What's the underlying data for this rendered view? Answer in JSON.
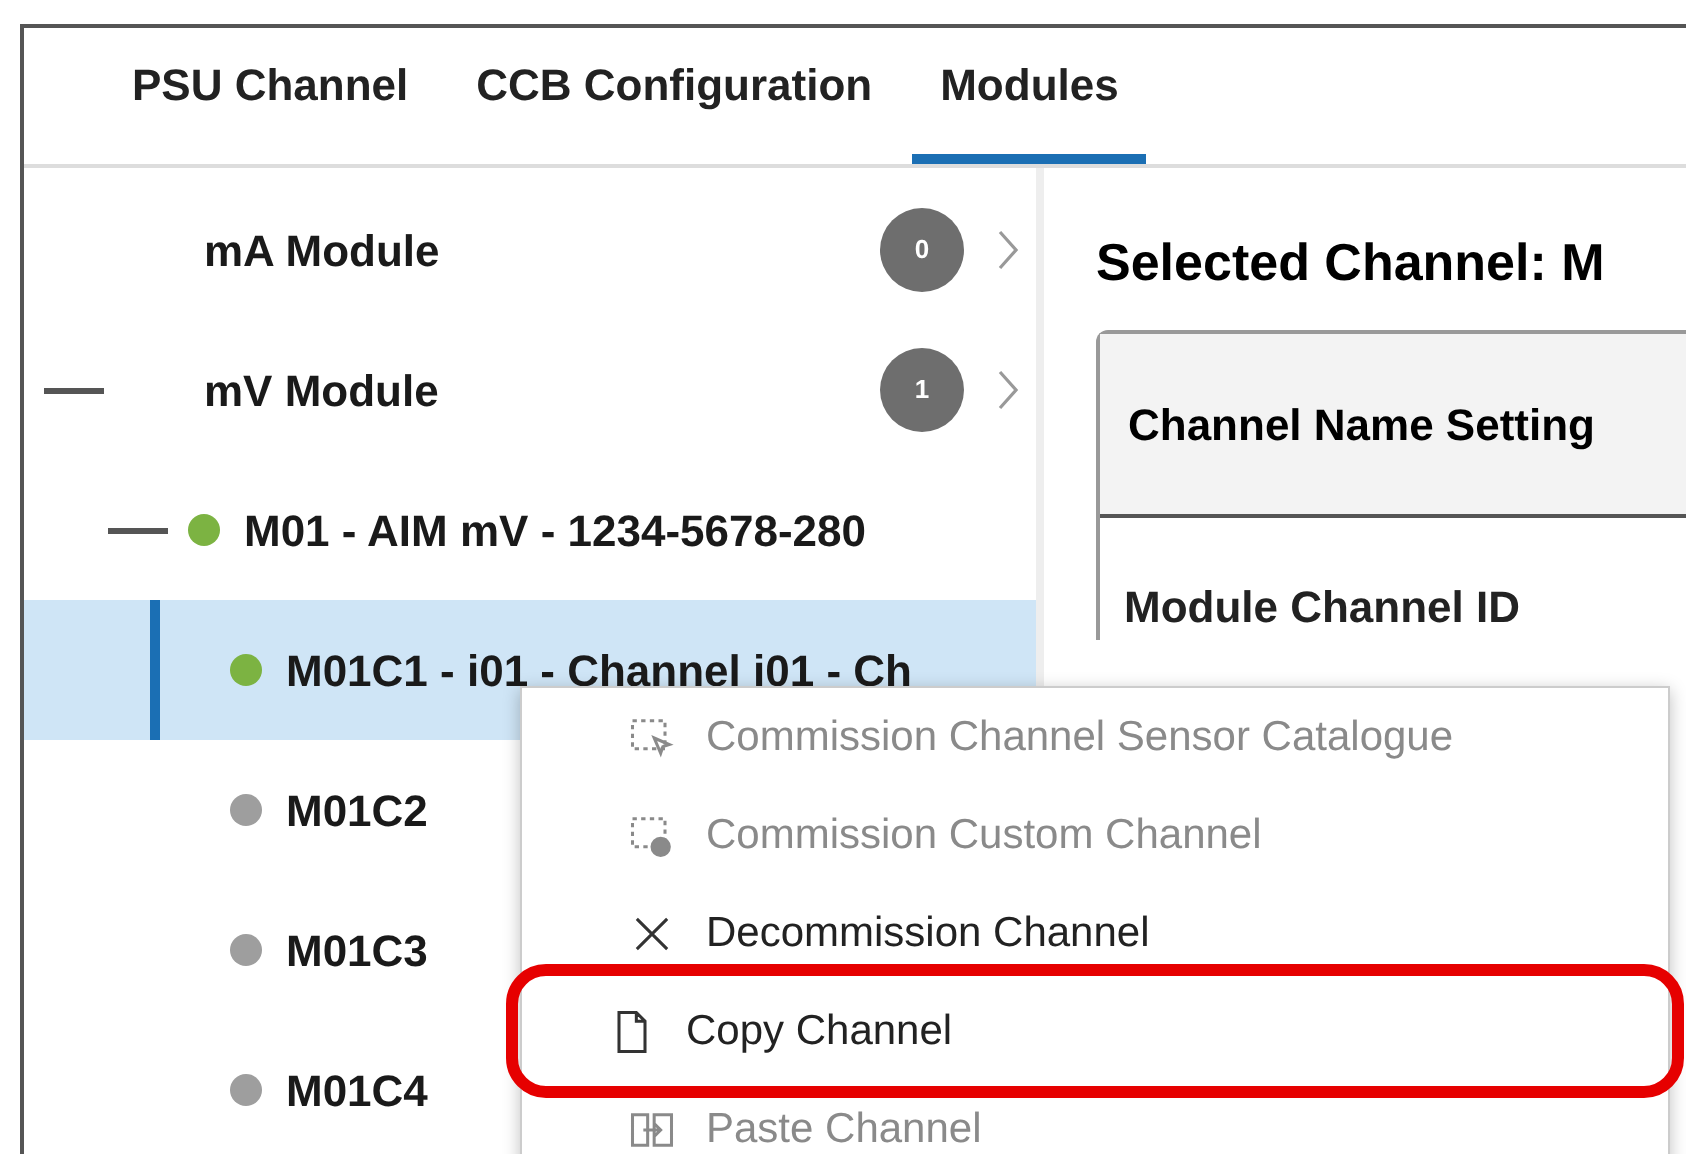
{
  "tabs": [
    {
      "label": "PSU Channel",
      "selected": false
    },
    {
      "label": "CCB Configuration",
      "selected": false
    },
    {
      "label": "Modules",
      "selected": true
    }
  ],
  "tree": [
    {
      "label": "mA Module",
      "badge": "0",
      "expanded": false,
      "selected": false
    },
    {
      "label": "mV Module",
      "badge": "1",
      "expanded": true,
      "selected": false,
      "children": [
        {
          "label": "M01 - AIM mV - 1234-5678-280",
          "color": "#7cb342",
          "expanded": true,
          "selected": false,
          "children": [
            {
              "label": "M01C1 - i01 - Channel i01 - Ch",
              "color": "#7cb342",
              "selected": true
            },
            {
              "label": "M01C2",
              "color": "#9e9e9e",
              "selected": false
            },
            {
              "label": "M01C3",
              "color": "#9e9e9e",
              "selected": false
            },
            {
              "label": "M01C4",
              "color": "#9e9e9e",
              "selected": false
            }
          ]
        }
      ]
    }
  ],
  "detail": {
    "title": "Selected Channel: M",
    "section_header": "Channel Name Setting",
    "field_label": "Module Channel ID"
  },
  "context_menu": [
    {
      "kind": "sensor",
      "label": "Commission Channel Sensor Catalogue",
      "disabled": true,
      "highlighted": false
    },
    {
      "kind": "custom",
      "label": "Commission Custom Channel",
      "disabled": true,
      "highlighted": false
    },
    {
      "kind": "decommission",
      "label": "Decommission Channel",
      "disabled": false,
      "highlighted": false
    },
    {
      "kind": "copy",
      "label": "Copy Channel",
      "disabled": false,
      "highlighted": true
    },
    {
      "kind": "paste",
      "label": "Paste Channel",
      "disabled": true,
      "highlighted": false
    }
  ]
}
